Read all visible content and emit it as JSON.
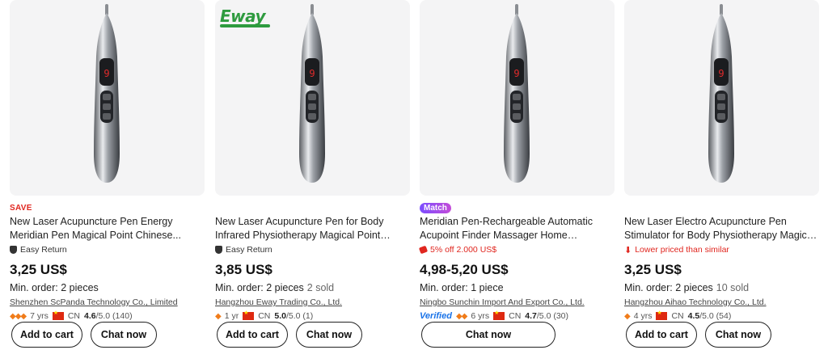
{
  "products": [
    {
      "tag": "SAVE",
      "title": "New Laser Acupuncture Pen Energy Meridian Pen Magical Point Chinese...",
      "badge": "Easy Return",
      "price": "3,25 US$",
      "moq": "Min. order: 2 pieces",
      "sold": "",
      "supplier": "Shenzhen ScPanda Technology Co., Limited",
      "years": "7 yrs",
      "country": "CN",
      "rating": "4.6",
      "rating_suffix": "/5.0 (140)",
      "add_to_cart": "Add to cart",
      "chat": "Chat now"
    },
    {
      "logo": "Eway",
      "title": "New Laser Acupuncture Pen for Body Infrared Physiotherapy Magical Point Chinese Medicine Energy Meridian Pen",
      "badge": "Easy Return",
      "price": "3,85 US$",
      "moq": "Min. order: 2 pieces",
      "sold": "2 sold",
      "supplier": "Hangzhou Eway Trading Co., Ltd.",
      "years": "1 yr",
      "country": "CN",
      "rating": "5.0",
      "rating_suffix": "/5.0 (1)",
      "add_to_cart": "Add to cart",
      "chat": "Chat now"
    },
    {
      "tag": "Match",
      "title": "Meridian Pen-Rechargeable Automatic Acupoint Finder Massager Home Electron...",
      "promo": "5% off 2.000 US$",
      "price": "4,98-5,20 US$",
      "moq": "Min. order: 1 piece",
      "sold": "",
      "supplier": "Ningbo Sunchin Import And Export Co., Ltd.",
      "verified": "Verified",
      "years": "6 yrs",
      "country": "CN",
      "rating": "4.7",
      "rating_suffix": "/5.0 (30)",
      "chat": "Chat now"
    },
    {
      "title": "New Laser Electro Acupuncture Pen Stimulator for Body Physiotherapy Magical Point Chinese Medicine Energy Meridian...",
      "promo": "Lower priced than similar",
      "price": "3,25 US$",
      "moq": "Min. order: 2 pieces",
      "sold": "10 sold",
      "supplier": "Hangzhou Aihao Technology Co., Ltd.",
      "years": "4 yrs",
      "country": "CN",
      "rating": "4.5",
      "rating_suffix": "/5.0 (54)",
      "add_to_cart": "Add to cart",
      "chat": "Chat now"
    }
  ],
  "colors": {
    "accent_red": "#e0261f",
    "verified_blue": "#1a73e8",
    "diamond_orange": "#f07c1a",
    "image_bg": "#f4f4f5"
  }
}
